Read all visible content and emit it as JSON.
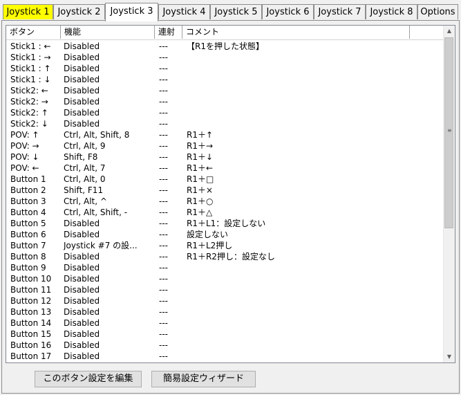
{
  "tabs": [
    {
      "label": "Joystick 1"
    },
    {
      "label": "Joystick 2"
    },
    {
      "label": "Joystick 3"
    },
    {
      "label": "Joystick 4"
    },
    {
      "label": "Joystick 5"
    },
    {
      "label": "Joystick 6"
    },
    {
      "label": "Joystick 7"
    },
    {
      "label": "Joystick 8"
    },
    {
      "label": "Options"
    }
  ],
  "colors": {
    "highlight_tab": "#ffff00"
  },
  "columns": [
    "ボタン",
    "機能",
    "連射",
    "コメント"
  ],
  "rows": [
    [
      "Stick1 : ←",
      "Disabled",
      "---",
      "【R1を押した状態】"
    ],
    [
      "Stick1 : →",
      "Disabled",
      "---",
      ""
    ],
    [
      "Stick1 : ↑",
      "Disabled",
      "---",
      ""
    ],
    [
      "Stick1 : ↓",
      "Disabled",
      "---",
      ""
    ],
    [
      "Stick2: ←",
      "Disabled",
      "---",
      ""
    ],
    [
      "Stick2: →",
      "Disabled",
      "---",
      ""
    ],
    [
      "Stick2: ↑",
      "Disabled",
      "---",
      ""
    ],
    [
      "Stick2: ↓",
      "Disabled",
      "---",
      ""
    ],
    [
      "POV: ↑",
      "Ctrl, Alt, Shift, 8",
      "---",
      "R1＋↑"
    ],
    [
      "POV: →",
      "Ctrl, Alt, 9",
      "---",
      "R1＋→"
    ],
    [
      "POV: ↓",
      "Shift, F8",
      "---",
      "R1＋↓"
    ],
    [
      "POV: ←",
      "Ctrl, Alt, 7",
      "---",
      "R1＋←"
    ],
    [
      "Button 1",
      "Ctrl, Alt, 0",
      "---",
      "R1＋□"
    ],
    [
      "Button 2",
      "Shift, F11",
      "---",
      "R1＋×"
    ],
    [
      "Button 3",
      "Ctrl, Alt, ^",
      "---",
      "R1＋○"
    ],
    [
      "Button 4",
      "Ctrl, Alt, Shift, -",
      "---",
      "R1＋△"
    ],
    [
      "Button 5",
      "Disabled",
      "---",
      "R1＋L1：設定しない"
    ],
    [
      "Button 6",
      "Disabled",
      "---",
      "設定しない"
    ],
    [
      "Button 7",
      "Joystick #7 の設...",
      "---",
      "R1＋L2押し"
    ],
    [
      "Button 8",
      "Disabled",
      "---",
      "R1＋R2押し：設定なし"
    ],
    [
      "Button 9",
      "Disabled",
      "---",
      ""
    ],
    [
      "Button 10",
      "Disabled",
      "---",
      ""
    ],
    [
      "Button 11",
      "Disabled",
      "---",
      ""
    ],
    [
      "Button 12",
      "Disabled",
      "---",
      ""
    ],
    [
      "Button 13",
      "Disabled",
      "---",
      ""
    ],
    [
      "Button 14",
      "Disabled",
      "---",
      ""
    ],
    [
      "Button 15",
      "Disabled",
      "---",
      ""
    ],
    [
      "Button 16",
      "Disabled",
      "---",
      ""
    ],
    [
      "Button 17",
      "Disabled",
      "---",
      ""
    ]
  ],
  "buttons": {
    "edit": "このボタン設定を編集",
    "wizard": "簡易設定ウィザード"
  },
  "icons": {
    "scroll_up": "▲",
    "scroll_down": "▼",
    "grip": "≡"
  }
}
